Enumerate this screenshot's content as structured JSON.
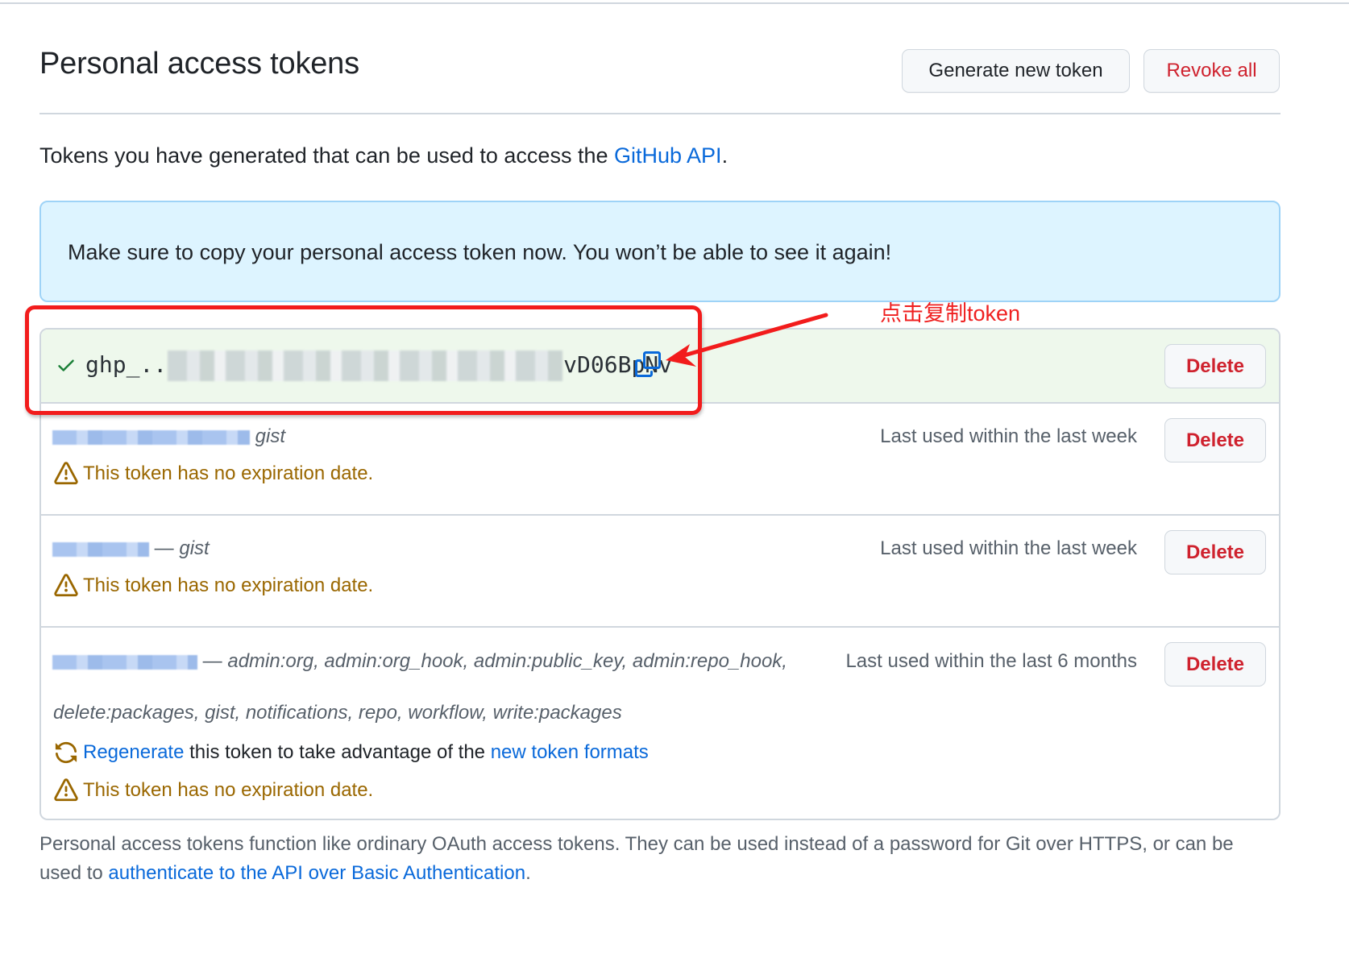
{
  "header": {
    "title": "Personal access tokens",
    "generate_label": "Generate new token",
    "revoke_label": "Revoke all"
  },
  "intro": {
    "text": "Tokens you have generated that can be used to access the ",
    "link": "GitHub API",
    "end": "."
  },
  "flash": {
    "message": "Make sure to copy your personal access token now. You won’t be able to see it again!"
  },
  "annotation": {
    "label": "点击复制token",
    "color": "#ef1f1f"
  },
  "new_token": {
    "prefix": "ghp_..",
    "suffix": "vD06BpNv",
    "delete_label": "Delete"
  },
  "tokens": [
    {
      "scopes": "gist",
      "last_used": "Last used within the last week",
      "warning": "This token has no expiration date.",
      "delete_label": "Delete"
    },
    {
      "dash": "—",
      "scopes": "gist",
      "last_used": "Last used within the last week",
      "warning": "This token has no expiration date.",
      "delete_label": "Delete"
    },
    {
      "dash": "—",
      "scopes_line1": "admin:org, admin:org_hook, admin:public_key, admin:repo_hook,",
      "last_used": "Last used within the last 6 months",
      "scopes_line2": "delete:packages, gist, notifications, repo, workflow, write:packages",
      "regen_link": "Regenerate",
      "regen_text": " this token to take advantage of the ",
      "regen_link2": "new token formats",
      "warning": "This token has no expiration date.",
      "delete_label": "Delete"
    }
  ],
  "footer": {
    "text": "Personal access tokens function like ordinary OAuth access tokens. They can be used instead of a password for Git over HTTPS, or can be used to ",
    "link": "authenticate to the API over Basic Authentication",
    "end": "."
  },
  "colors": {
    "link": "#0969da",
    "danger": "#cf222e",
    "warning": "#9a6700",
    "flash_bg": "#ddf4ff",
    "new_row_bg": "#eef8ec"
  }
}
